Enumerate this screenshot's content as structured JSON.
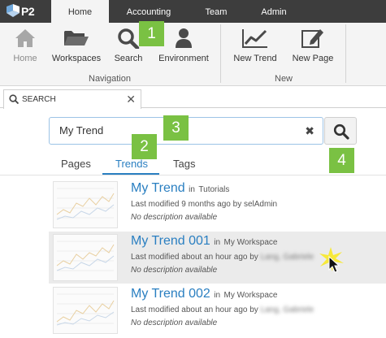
{
  "app": {
    "logo_text": "P2"
  },
  "nav": {
    "tabs": [
      {
        "label": "Home",
        "active": true
      },
      {
        "label": "Accounting"
      },
      {
        "label": "Team"
      },
      {
        "label": "Admin"
      }
    ]
  },
  "ribbon": {
    "buttons": {
      "home": {
        "label": "Home",
        "icon": "house-icon",
        "disabled": true
      },
      "workspaces": {
        "label": "Workspaces",
        "icon": "folder-icon"
      },
      "search": {
        "label": "Search",
        "icon": "magnifier-icon"
      },
      "environment": {
        "label": "Environment",
        "icon": "person-icon"
      },
      "new_trend": {
        "label": "New Trend",
        "icon": "line-chart-icon"
      },
      "new_page": {
        "label": "New Page",
        "icon": "pencil-page-icon"
      }
    },
    "groups": {
      "navigation": "Navigation",
      "new": "New"
    }
  },
  "doc_tab": {
    "label": "SEARCH",
    "icon": "search-icon",
    "close": "✕"
  },
  "search": {
    "value": "My Trend",
    "clear": "✖",
    "button_icon": "magnifier-icon"
  },
  "filters": {
    "tabs": [
      {
        "label": "Pages"
      },
      {
        "label": "Trends",
        "active": true
      },
      {
        "label": "Tags"
      }
    ]
  },
  "results": [
    {
      "name": "My Trend",
      "in_label": "in",
      "location": "Tutorials",
      "modified": "Last modified 9 months ago by selAdmin",
      "modified_prefix": "",
      "user": "",
      "description": "No description available"
    },
    {
      "name": "My Trend 001",
      "in_label": "in",
      "location": "My Workspace",
      "modified_prefix": "Last modified about an hour ago by",
      "user": "Lang, Gabriele",
      "description": "No description available"
    },
    {
      "name": "My Trend 002",
      "in_label": "in",
      "location": "My Workspace",
      "modified_prefix": "Last modified about an hour ago by",
      "user": "Lang, Gabriele",
      "description": "No description available"
    }
  ],
  "callouts": [
    "1",
    "2",
    "3",
    "4"
  ],
  "colors": {
    "accent": "#2a7fc1",
    "callout": "#7ac143",
    "topbar": "#3d3d3d"
  }
}
